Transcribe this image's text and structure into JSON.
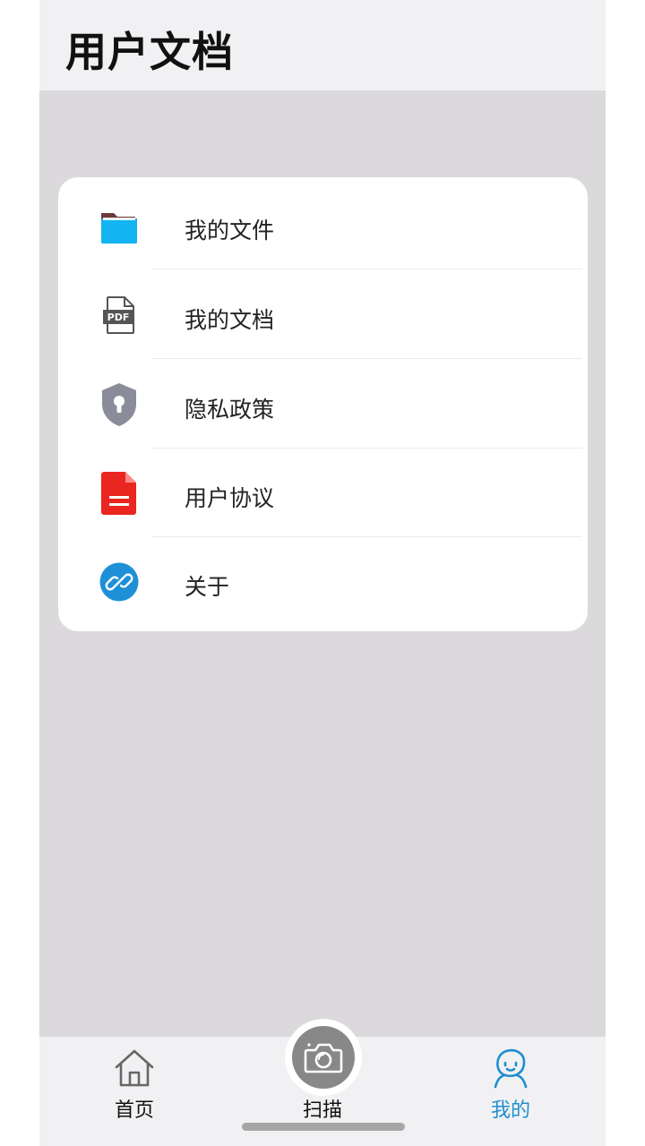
{
  "header": {
    "title": "用户文档"
  },
  "menu": {
    "items": [
      {
        "label": "我的文件",
        "icon": "folder-icon"
      },
      {
        "label": "我的文档",
        "icon": "pdf-document-icon"
      },
      {
        "label": "隐私政策",
        "icon": "shield-keyhole-icon"
      },
      {
        "label": "用户协议",
        "icon": "agreement-document-icon"
      },
      {
        "label": "关于",
        "icon": "link-icon"
      }
    ]
  },
  "tabbar": {
    "home": {
      "label": "首页",
      "icon": "home-icon"
    },
    "scan": {
      "label": "扫描",
      "icon": "camera-icon"
    },
    "mine": {
      "label": "我的",
      "icon": "user-icon",
      "active": true
    }
  },
  "colors": {
    "accent": "#1e8fd2",
    "folder": "#16a8ec",
    "shield": "#8a8d99",
    "agreement": "#e9261f",
    "link": "#1e90d8"
  }
}
